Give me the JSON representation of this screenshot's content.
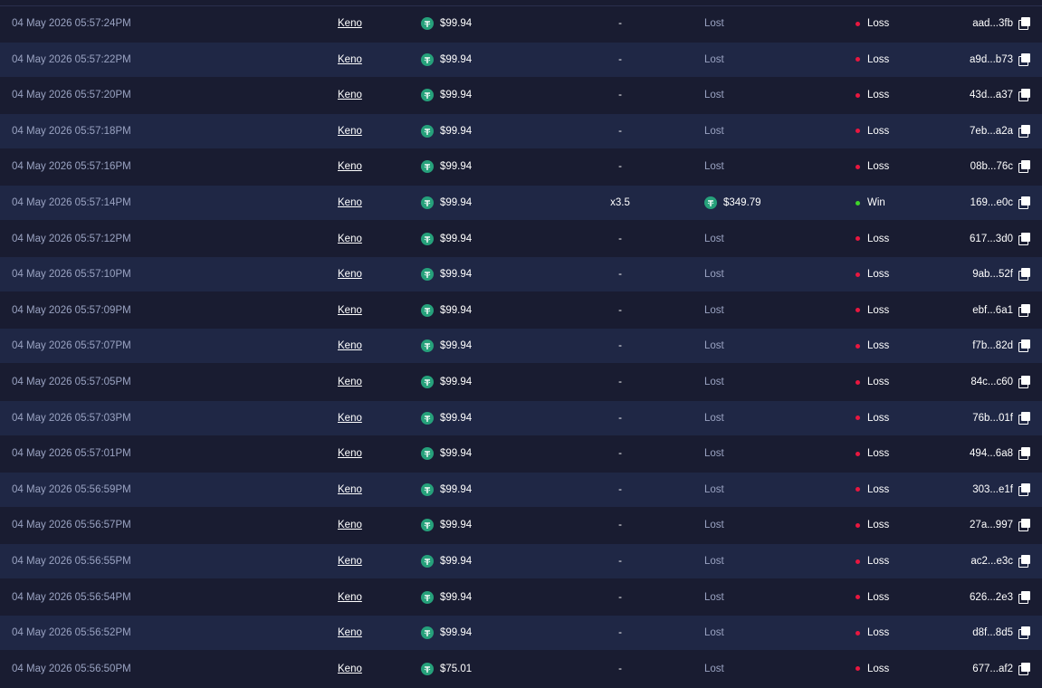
{
  "colors": {
    "loss_dot": "#e8173f",
    "win_dot": "#3fd42a",
    "token": "#26a17b"
  },
  "icons": {
    "currency": "tether-usdt-icon",
    "copy": "copy-icon"
  },
  "rows": [
    {
      "date": "04 May 2026 05:57:24PM",
      "game": "Keno",
      "bet": "$99.94",
      "multiplier": "-",
      "payout": "Lost",
      "result": "Loss",
      "hash": "aad...3fb"
    },
    {
      "date": "04 May 2026 05:57:22PM",
      "game": "Keno",
      "bet": "$99.94",
      "multiplier": "-",
      "payout": "Lost",
      "result": "Loss",
      "hash": "a9d...b73"
    },
    {
      "date": "04 May 2026 05:57:20PM",
      "game": "Keno",
      "bet": "$99.94",
      "multiplier": "-",
      "payout": "Lost",
      "result": "Loss",
      "hash": "43d...a37"
    },
    {
      "date": "04 May 2026 05:57:18PM",
      "game": "Keno",
      "bet": "$99.94",
      "multiplier": "-",
      "payout": "Lost",
      "result": "Loss",
      "hash": "7eb...a2a"
    },
    {
      "date": "04 May 2026 05:57:16PM",
      "game": "Keno",
      "bet": "$99.94",
      "multiplier": "-",
      "payout": "Lost",
      "result": "Loss",
      "hash": "08b...76c"
    },
    {
      "date": "04 May 2026 05:57:14PM",
      "game": "Keno",
      "bet": "$99.94",
      "multiplier": "x3.5",
      "payout": "$349.79",
      "result": "Win",
      "hash": "169...e0c"
    },
    {
      "date": "04 May 2026 05:57:12PM",
      "game": "Keno",
      "bet": "$99.94",
      "multiplier": "-",
      "payout": "Lost",
      "result": "Loss",
      "hash": "617...3d0"
    },
    {
      "date": "04 May 2026 05:57:10PM",
      "game": "Keno",
      "bet": "$99.94",
      "multiplier": "-",
      "payout": "Lost",
      "result": "Loss",
      "hash": "9ab...52f"
    },
    {
      "date": "04 May 2026 05:57:09PM",
      "game": "Keno",
      "bet": "$99.94",
      "multiplier": "-",
      "payout": "Lost",
      "result": "Loss",
      "hash": "ebf...6a1"
    },
    {
      "date": "04 May 2026 05:57:07PM",
      "game": "Keno",
      "bet": "$99.94",
      "multiplier": "-",
      "payout": "Lost",
      "result": "Loss",
      "hash": "f7b...82d"
    },
    {
      "date": "04 May 2026 05:57:05PM",
      "game": "Keno",
      "bet": "$99.94",
      "multiplier": "-",
      "payout": "Lost",
      "result": "Loss",
      "hash": "84c...c60"
    },
    {
      "date": "04 May 2026 05:57:03PM",
      "game": "Keno",
      "bet": "$99.94",
      "multiplier": "-",
      "payout": "Lost",
      "result": "Loss",
      "hash": "76b...01f"
    },
    {
      "date": "04 May 2026 05:57:01PM",
      "game": "Keno",
      "bet": "$99.94",
      "multiplier": "-",
      "payout": "Lost",
      "result": "Loss",
      "hash": "494...6a8"
    },
    {
      "date": "04 May 2026 05:56:59PM",
      "game": "Keno",
      "bet": "$99.94",
      "multiplier": "-",
      "payout": "Lost",
      "result": "Loss",
      "hash": "303...e1f"
    },
    {
      "date": "04 May 2026 05:56:57PM",
      "game": "Keno",
      "bet": "$99.94",
      "multiplier": "-",
      "payout": "Lost",
      "result": "Loss",
      "hash": "27a...997"
    },
    {
      "date": "04 May 2026 05:56:55PM",
      "game": "Keno",
      "bet": "$99.94",
      "multiplier": "-",
      "payout": "Lost",
      "result": "Loss",
      "hash": "ac2...e3c"
    },
    {
      "date": "04 May 2026 05:56:54PM",
      "game": "Keno",
      "bet": "$99.94",
      "multiplier": "-",
      "payout": "Lost",
      "result": "Loss",
      "hash": "626...2e3"
    },
    {
      "date": "04 May 2026 05:56:52PM",
      "game": "Keno",
      "bet": "$99.94",
      "multiplier": "-",
      "payout": "Lost",
      "result": "Loss",
      "hash": "d8f...8d5"
    },
    {
      "date": "04 May 2026 05:56:50PM",
      "game": "Keno",
      "bet": "$75.01",
      "multiplier": "-",
      "payout": "Lost",
      "result": "Loss",
      "hash": "677...af2"
    }
  ]
}
